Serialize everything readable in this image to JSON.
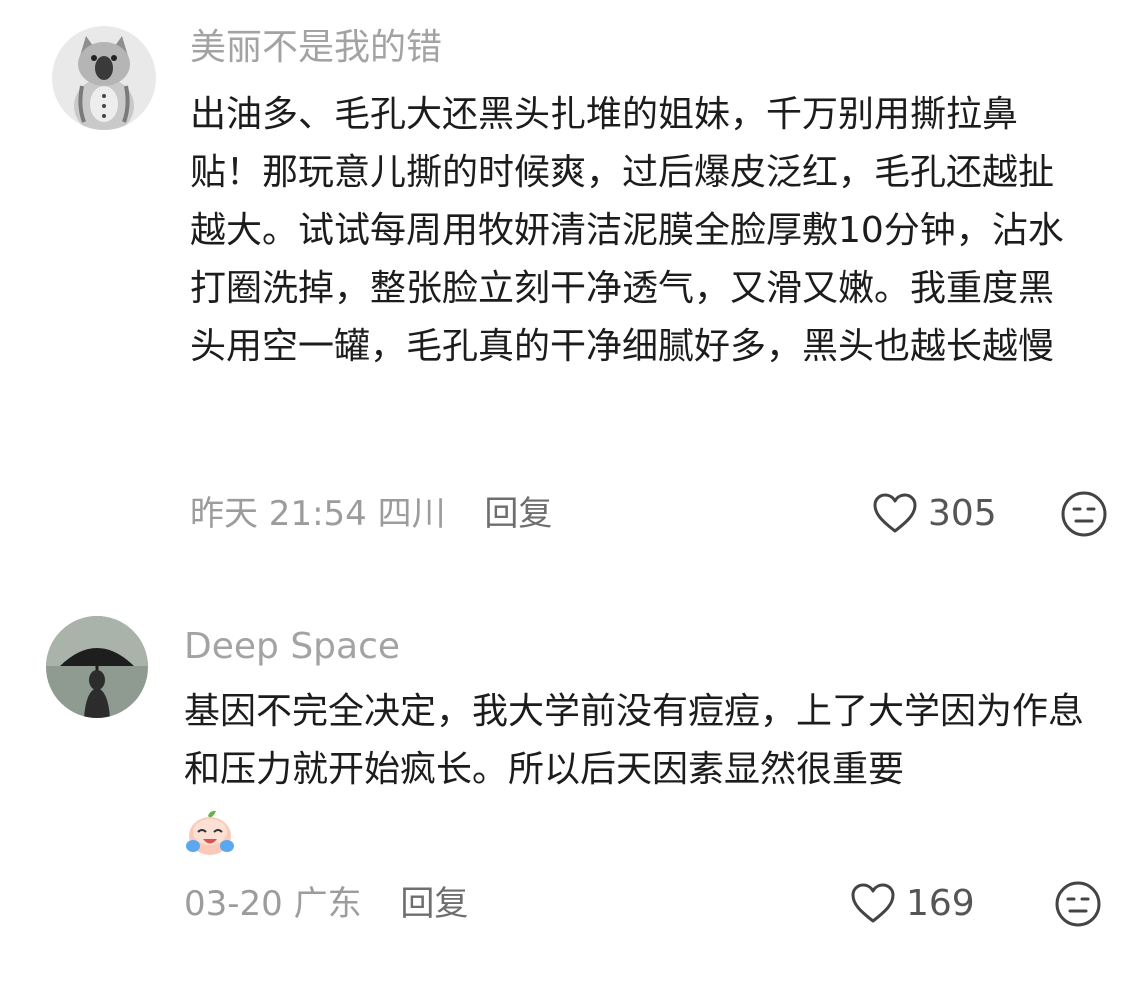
{
  "comments": [
    {
      "username": "美丽不是我的错",
      "avatar_icon": "cat-figurine-avatar",
      "text": "出油多、毛孔大还黑头扎堆的姐妹，千万别用撕拉鼻贴！那玩意儿撕的时候爽，过后爆皮泛红，毛孔还越扯越大。试试每周用牧妍清洁泥膜全脸厚敷10分钟，沾水打圈洗掉，整张脸立刻干净透气，又滑又嫩。我重度黑头用空一罐，毛孔真的干净细腻好多，黑头也越长越慢",
      "time": "昨天 21:54",
      "location": "四川",
      "reply_label": "回复",
      "likes": "305"
    },
    {
      "username": "Deep Space",
      "avatar_icon": "umbrella-photo-avatar",
      "text": "基因不完全决定，我大学前没有痘痘，上了大学因为作息和压力就开始疯长。所以后天因素显然很重要",
      "emoji": "crying-peach-emoji",
      "time": "03-20",
      "location": "广东",
      "reply_label": "回复",
      "likes": "169"
    }
  ],
  "colors": {
    "username": "#a3a3a3",
    "text": "#1c1c1c",
    "meta": "#9c9c9c",
    "icon": "#444444"
  }
}
